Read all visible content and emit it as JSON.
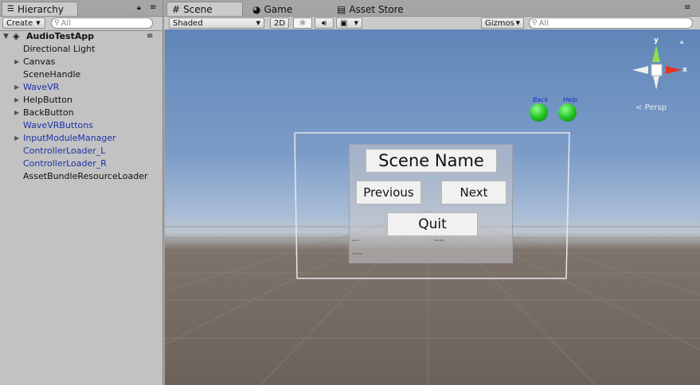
{
  "hierarchy": {
    "tab_label": "Hierarchy",
    "create_label": "Create",
    "search_placeholder": "All",
    "root": "AudioTestApp",
    "items": [
      {
        "label": "Directional Light",
        "expandable": false,
        "prefab": false
      },
      {
        "label": "Canvas",
        "expandable": true,
        "prefab": false
      },
      {
        "label": "SceneHandle",
        "expandable": false,
        "prefab": false
      },
      {
        "label": "WaveVR",
        "expandable": true,
        "prefab": true
      },
      {
        "label": "HelpButton",
        "expandable": true,
        "prefab": false
      },
      {
        "label": "BackButton",
        "expandable": true,
        "prefab": false
      },
      {
        "label": "WaveVRButtons",
        "expandable": false,
        "prefab": true
      },
      {
        "label": "InputModuleManager",
        "expandable": true,
        "prefab": true
      },
      {
        "label": "ControllerLoader_L",
        "expandable": false,
        "prefab": true
      },
      {
        "label": "ControllerLoader_R",
        "expandable": false,
        "prefab": true
      },
      {
        "label": "AssetBundleResourceLoader",
        "expandable": false,
        "prefab": false
      }
    ]
  },
  "scene_tabs": [
    {
      "label": "Scene",
      "icon": "grid-icon",
      "active": true
    },
    {
      "label": "Game",
      "icon": "pacman-icon",
      "active": false
    },
    {
      "label": "Asset Store",
      "icon": "store-icon",
      "active": false
    }
  ],
  "scene_toolbar": {
    "draw_mode": "Shaded",
    "mode_2d": "2D",
    "gizmos": "Gizmos",
    "search_placeholder": "All"
  },
  "gizmo": {
    "y": "y",
    "x": "x",
    "persp": "Persp"
  },
  "world_labels": {
    "back": "Back",
    "help": "Help"
  },
  "panel": {
    "title": "Scene Name",
    "previous": "Previous",
    "next": "Next",
    "quit": "Quit",
    "small_left": "Audio",
    "small_right": "Info Play",
    "small_bottom": "HTC Vive"
  },
  "colors": {
    "prefab_text": "#1d32a8",
    "ball": "#1fbf1f"
  }
}
